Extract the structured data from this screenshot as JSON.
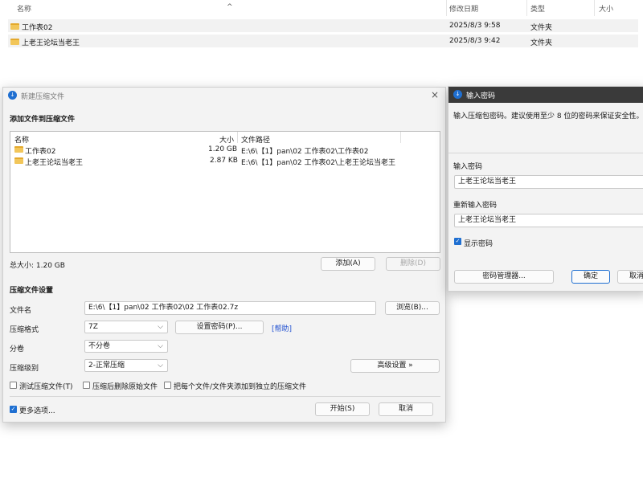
{
  "explorer": {
    "columns": {
      "name": "名称",
      "modified": "修改日期",
      "type": "类型",
      "size": "大小"
    },
    "rows": [
      {
        "name": "工作表02",
        "modified": "2025/8/3 9:58",
        "type": "文件夹"
      },
      {
        "name": "上老王论坛当老王",
        "modified": "2025/8/3 9:42",
        "type": "文件夹"
      }
    ]
  },
  "archive_dialog": {
    "title": "新建压缩文件",
    "add_section_title": "添加文件到压缩文件",
    "list_columns": {
      "name": "名称",
      "size": "大小",
      "path": "文件路径"
    },
    "files": [
      {
        "name": "工作表02",
        "size": "1.20 GB",
        "path": "E:\\6\\【1】pan\\02 工作表02\\工作表02"
      },
      {
        "name": "上老王论坛当老王",
        "size": "2.87 KB",
        "path": "E:\\6\\【1】pan\\02 工作表02\\上老王论坛当老王"
      }
    ],
    "total_size": "总大小: 1.20 GB",
    "add_button": "添加(A)",
    "delete_button": "删除(D)",
    "settings_title": "压缩文件设置",
    "filename_label": "文件名",
    "filename_value": "E:\\6\\【1】pan\\02 工作表02\\02 工作表02.7z",
    "browse_button": "浏览(B)...",
    "format_label": "压缩格式",
    "format_value": "7Z",
    "set_password_button": "设置密码(P)...",
    "help_link": "[帮助]",
    "split_label": "分卷",
    "split_value": "不分卷",
    "level_label": "压缩级别",
    "level_value": "2-正常压缩",
    "advanced_button": "高级设置 »",
    "test_checkbox": "测试压缩文件(T)",
    "delete_source_checkbox": "压缩后删除原始文件",
    "separate_checkbox": "把每个文件/文件夹添加到独立的压缩文件",
    "more_options_checkbox": "更多选项...",
    "start_button": "开始(S)",
    "cancel_button": "取消"
  },
  "password_dialog": {
    "title": "输入密码",
    "description": "输入压缩包密码。建议使用至少 8 位的密码来保证安全性。",
    "password_label": "输入密码",
    "password_value": "上老王论坛当老王",
    "confirm_label": "重新输入密码",
    "confirm_value": "上老王论坛当老王",
    "show_password_checkbox": "显示密码",
    "manager_button": "密码管理器...",
    "ok_button": "确定",
    "cancel_button": "取消"
  },
  "colors": {
    "accent": "#1f6fd1",
    "folder": "#f2c65a",
    "titlebar_dark": "#3a3a3a"
  }
}
